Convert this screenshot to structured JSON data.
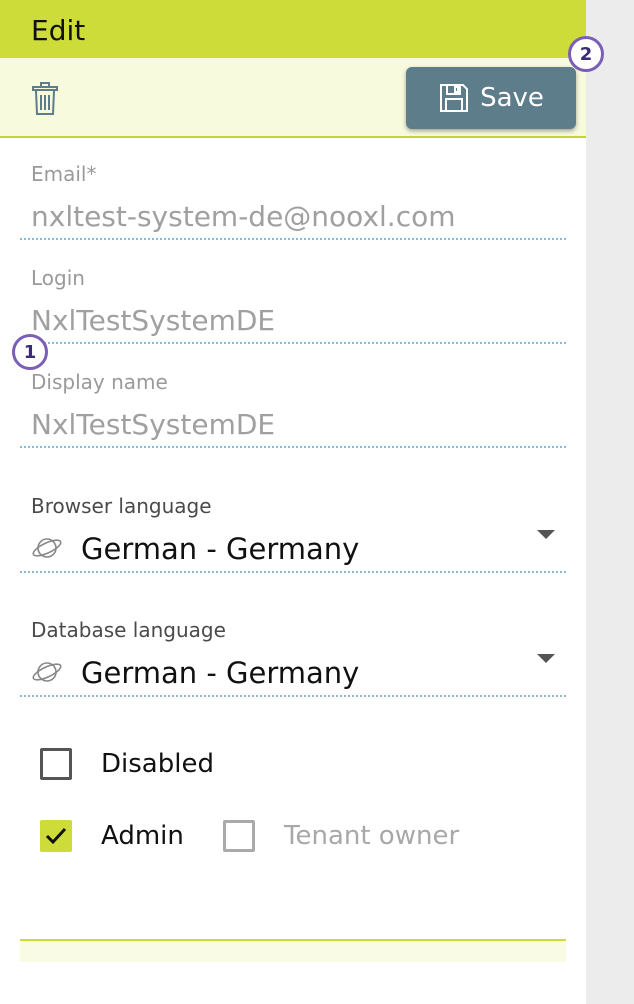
{
  "header": {
    "title": "Edit"
  },
  "toolbar": {
    "save_label": "Save",
    "delete_icon": "trash-icon",
    "save_icon": "floppy-disk-icon"
  },
  "form": {
    "email": {
      "label": "Email*",
      "value": "nxltest-system-de@nooxl.com"
    },
    "login": {
      "label": "Login",
      "value": "NxlTestSystemDE"
    },
    "display_name": {
      "label": "Display name",
      "value": "NxlTestSystemDE"
    },
    "browser_language": {
      "label": "Browser language",
      "value": "German - Germany",
      "icon": "planet-icon"
    },
    "database_language": {
      "label": "Database language",
      "value": "German - Germany",
      "icon": "planet-icon"
    },
    "disabled": {
      "label": "Disabled",
      "checked": false
    },
    "admin": {
      "label": "Admin",
      "checked": true
    },
    "tenant_owner": {
      "label": "Tenant owner",
      "checked": false
    }
  },
  "markers": [
    "1",
    "2"
  ],
  "colors": {
    "accent": "#cddc39",
    "save_button": "#5e7d8b",
    "marker": "#7b5fb5"
  }
}
